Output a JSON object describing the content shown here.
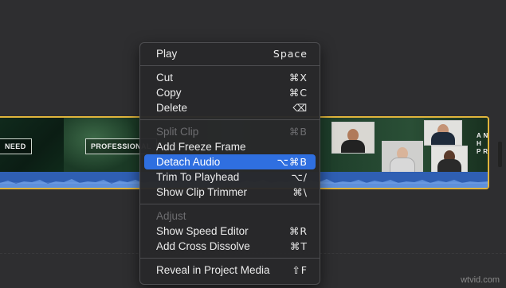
{
  "clip": {
    "label_left": "NEED",
    "label_mid": "PROFESSIONAL",
    "label_right": "A N\nH\nP R"
  },
  "menu": {
    "play": {
      "label": "Play",
      "shortcut": "Space"
    },
    "cut": {
      "label": "Cut",
      "shortcut": "⌘X"
    },
    "copy": {
      "label": "Copy",
      "shortcut": "⌘C"
    },
    "delete": {
      "label": "Delete",
      "shortcut": "⌫"
    },
    "split_clip": {
      "label": "Split Clip",
      "shortcut": "⌘B"
    },
    "add_freeze_frame": {
      "label": "Add Freeze Frame",
      "shortcut": ""
    },
    "detach_audio": {
      "label": "Detach Audio",
      "shortcut": "⌥⌘B"
    },
    "trim_to_playhead": {
      "label": "Trim To Playhead",
      "shortcut": "⌥/"
    },
    "show_clip_trimmer": {
      "label": "Show Clip Trimmer",
      "shortcut": "⌘\\"
    },
    "adjust": {
      "label": "Adjust",
      "shortcut": ""
    },
    "show_speed_editor": {
      "label": "Show Speed Editor",
      "shortcut": "⌘R"
    },
    "add_cross_dissolve": {
      "label": "Add Cross Dissolve",
      "shortcut": "⌘T"
    },
    "reveal_in_project_media": {
      "label": "Reveal in Project Media",
      "shortcut": "⇧F"
    }
  },
  "colors": {
    "highlight": "#2f6fe0",
    "clip_border": "#e0b53c",
    "audio": "#2f5fb3"
  },
  "watermark": "wtvid.com"
}
